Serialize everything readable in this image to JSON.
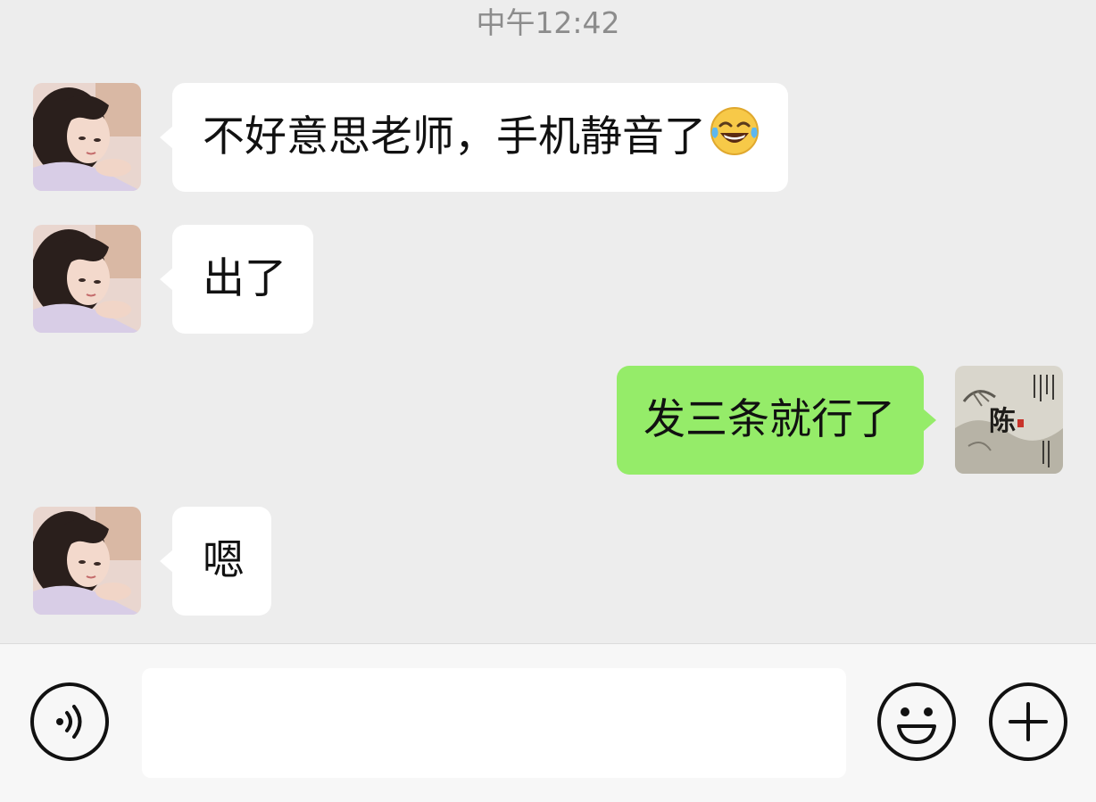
{
  "chat": {
    "timestamp": "中午12:42",
    "messages": [
      {
        "side": "incoming",
        "text": "不好意思老师，手机静音了",
        "emoji": "face-with-tears-of-joy"
      },
      {
        "side": "incoming",
        "text": "出了"
      },
      {
        "side": "outgoing",
        "text": "发三条就行了"
      },
      {
        "side": "incoming",
        "text": "嗯"
      }
    ]
  },
  "input_bar": {
    "text_value": "",
    "voice_icon": "voice-icon",
    "emoji_icon": "emoji-icon",
    "plus_icon": "plus-icon"
  },
  "colors": {
    "background": "#ededed",
    "incoming_bubble": "#ffffff",
    "outgoing_bubble": "#95ec69",
    "timestamp_text": "#8c8c8c",
    "input_bar": "#f7f7f7"
  },
  "my_avatar": {
    "label": "陈"
  }
}
